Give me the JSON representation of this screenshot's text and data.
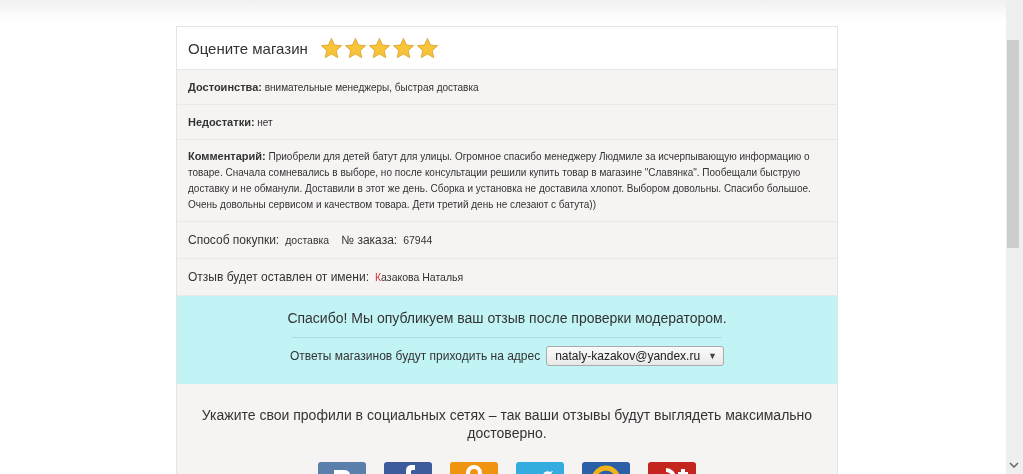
{
  "rating": {
    "title": "Оцените магазин",
    "stars": 5
  },
  "review": {
    "pros": {
      "label": "Достоинства:",
      "value": "внимательные менеджеры, быстрая доставка"
    },
    "cons": {
      "label": "Недостатки:",
      "value": "нет"
    },
    "comment": {
      "label": "Комментарий:",
      "value": "Приобрели для детей батут для улицы. Огромное спасибо менеджеру Людмиле за исчерпывающую информацию о товаре. Сначала сомневались в выборе, но после консультации решили купить товар в магазине \"Славянка\". Пообещали быструю доставку и не обманули. Доставили в этот же день. Сборка и установка не доставила хлопот. Выбором довольны. Спасибо большое. Очень довольны сервисом и качеством товара. Дети третий день не слезают с батута))"
    },
    "purchase": {
      "method_label": "Способ покупки:",
      "method": "доставка",
      "order_label": "№ заказа:",
      "order": "67944"
    },
    "author": {
      "label": "Отзыв будет оставлен от имени:",
      "name": "Казакова Наталья"
    }
  },
  "notice": {
    "message": "Спасибо! Мы опубликуем ваш отзыв после проверки модератором.",
    "email_label": "Ответы магазинов будут приходить на адрес",
    "email": "nataly-kazakov@yandex.ru",
    "dropdown_arrow": "▼"
  },
  "social": {
    "prompt": "Укажите свои профили в социальных сетях – так ваши отзывы будут выглядеть максимально достоверно.",
    "buttons": [
      {
        "kind": "vk",
        "color": "#5a7fab"
      },
      {
        "kind": "facebook",
        "color": "#3b5b9b"
      },
      {
        "kind": "odnoklassniki",
        "color": "#f0930f"
      },
      {
        "kind": "twitter",
        "color": "#35ace0"
      },
      {
        "kind": "mailru",
        "color": "#2b5fa6"
      },
      {
        "kind": "googleplus",
        "color": "#c4251d"
      }
    ]
  }
}
